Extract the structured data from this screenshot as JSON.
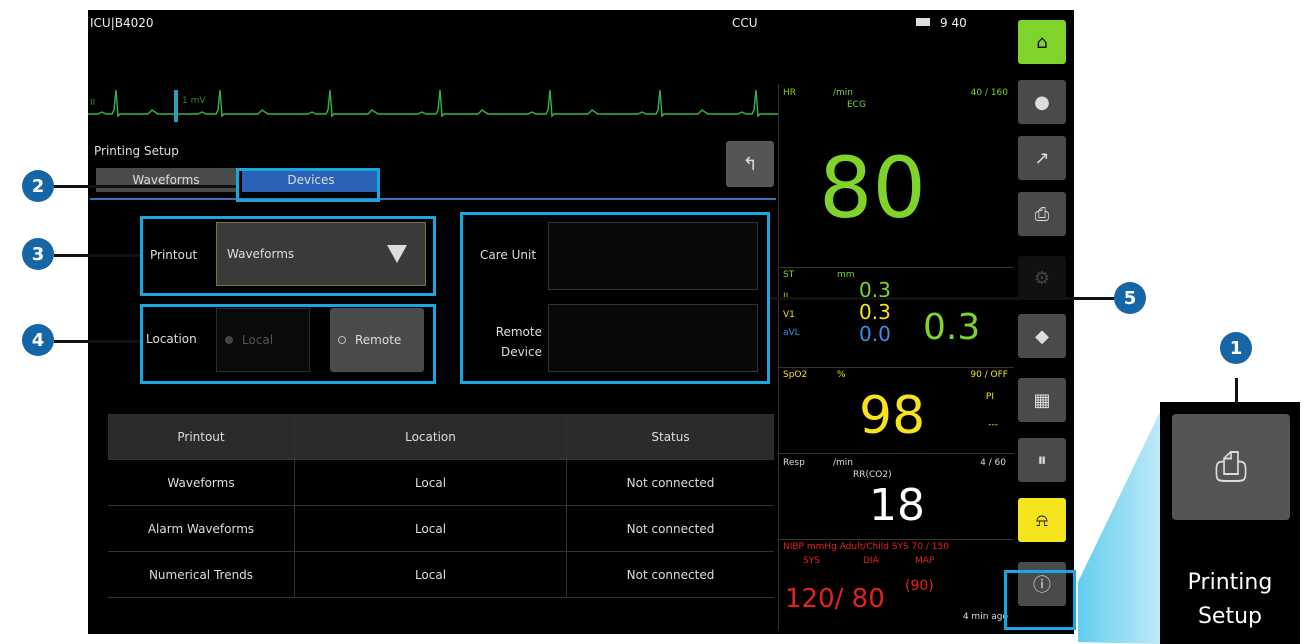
{
  "topbar": {
    "unit": "ICU|B4020",
    "care_unit": "CCU",
    "clock": "9 40"
  },
  "ecg": {
    "lead": "II",
    "gain": "1 mV"
  },
  "panel": {
    "title": "Printing Setup",
    "tabs": [
      "Waveforms",
      "Devices"
    ],
    "printout_label": "Printout",
    "printout_value": "Waveforms",
    "location_label": "Location",
    "location_options": [
      "Local",
      "Remote"
    ],
    "care_unit_label": "Care Unit",
    "remote_device_label": "Remote\nDevice"
  },
  "table": {
    "headers": [
      "Printout",
      "Location",
      "Status"
    ],
    "rows": [
      [
        "Waveforms",
        "Local",
        "Not connected"
      ],
      [
        "Alarm Waveforms",
        "Local",
        "Not connected"
      ],
      [
        "Numerical Trends",
        "Local",
        "Not connected"
      ]
    ]
  },
  "params": {
    "hr": {
      "label": "HR",
      "unit": "/min",
      "limits": "40 / 160",
      "source": "ECG",
      "value": "80"
    },
    "st": {
      "label": "ST",
      "unit": "mm",
      "leads": [
        "II",
        "V1",
        "aVL"
      ],
      "values": [
        "0.3",
        "0.3",
        "0.0"
      ],
      "big": "0.3"
    },
    "spo2": {
      "label": "SpO2",
      "unit": "%",
      "limits": "90 / OFF",
      "value": "98",
      "pi_label": "PI",
      "pi_value": "---"
    },
    "resp": {
      "label": "Resp",
      "unit": "/min",
      "source": "RR(CO2)",
      "limits": "4 / 60",
      "value": "18"
    },
    "nibp": {
      "header": "NIBP  mmHg  Adult/Child  SYS 70 / 150",
      "sub": [
        "SYS",
        "DIA",
        "MAP"
      ],
      "value": "120/ 80",
      "map": "(90)",
      "time": "4 min ago"
    }
  },
  "callouts": [
    "1",
    "2",
    "3",
    "4",
    "5"
  ],
  "zoom": {
    "label": "Printing Setup"
  },
  "colors": {
    "green": "#7fd32a",
    "yellow": "#f5e31c",
    "blue": "#3b8ee8",
    "red": "#e22222",
    "callout": "#1aa6df"
  },
  "sidebar_icons": [
    "home-icon",
    "patient-icon",
    "trends-icon",
    "print-icon",
    "monitor-icon",
    "pump-icon",
    "layout-icon",
    "pause-icon",
    "alarm-silence-icon",
    "more-icon"
  ]
}
